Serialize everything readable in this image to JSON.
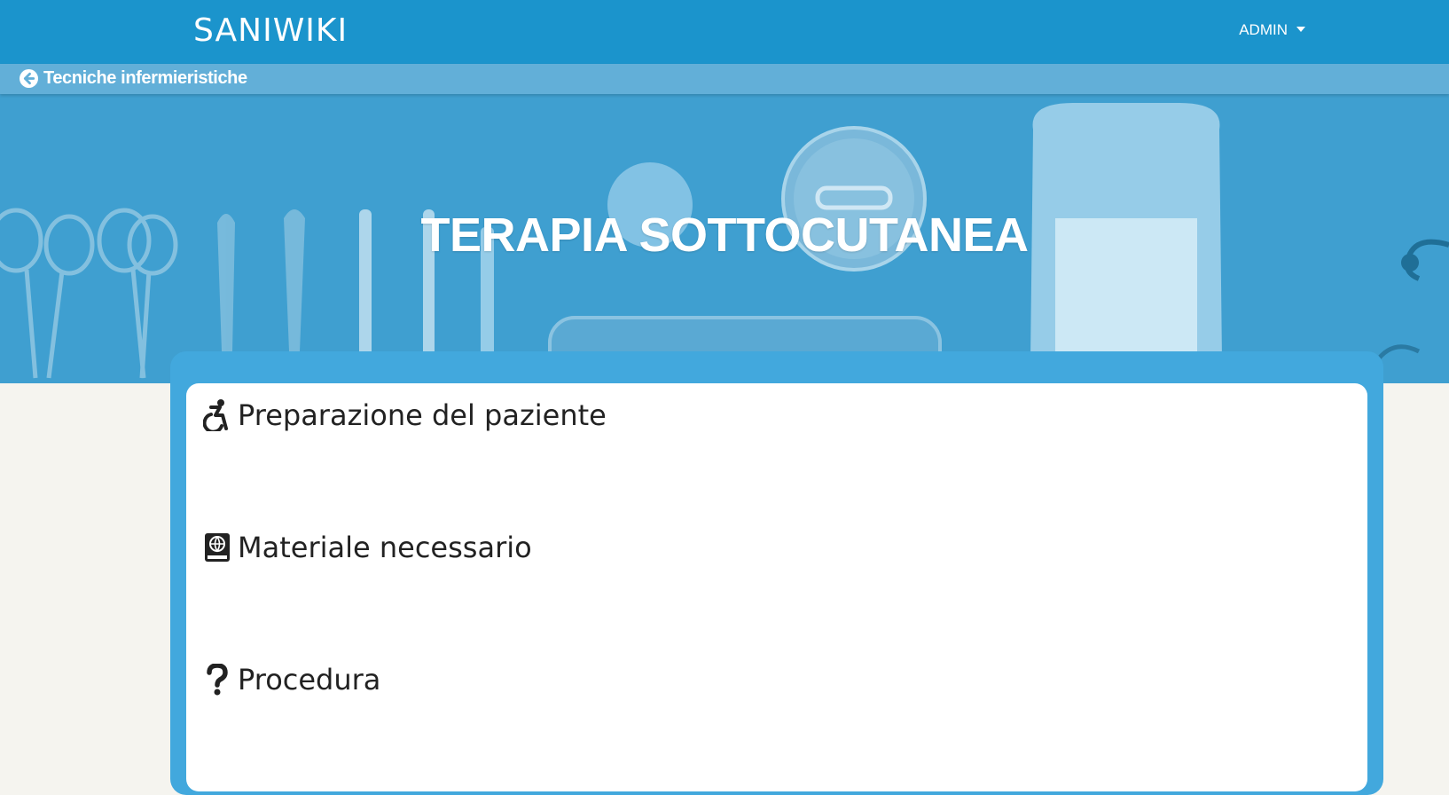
{
  "navbar": {
    "brand": "SANIWIKI",
    "user_menu": "ADMIN"
  },
  "breadcrumb": {
    "back_label": "Tecniche infermieristiche"
  },
  "hero": {
    "title": "TERAPIA SOTTOCUTANEA"
  },
  "sections": [
    {
      "label": "Preparazione del paziente",
      "icon": "wheelchair-icon"
    },
    {
      "label": "Materiale necessario",
      "icon": "book-globe-icon"
    },
    {
      "label": "Procedura",
      "icon": "question-icon"
    }
  ],
  "colors": {
    "navbar": "#1b94cc",
    "breadcrumb_bar": "#62afd8",
    "hero_overlay": "#3e9fd0",
    "card_border": "#42a8dd",
    "page_background": "#f5f4ef"
  }
}
